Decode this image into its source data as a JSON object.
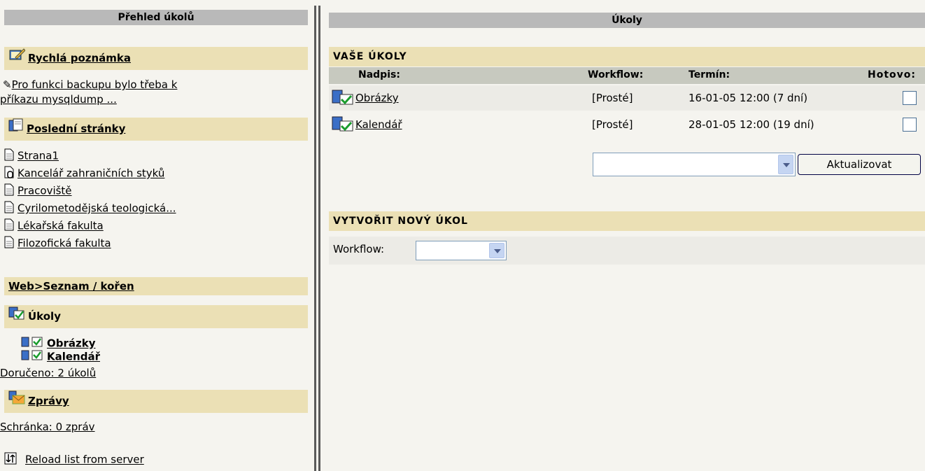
{
  "left": {
    "title": "Přehled úkolů",
    "quick_note": {
      "heading": "Rychlá poznámka",
      "line1": "Pro funkci backupu bylo třeba k",
      "line2": "příkazu mysqldump ..."
    },
    "recent_pages": {
      "heading": "Poslední stránky",
      "items": [
        "Strana1",
        "Kancelář zahraničních styků",
        "Pracoviště",
        "Cyrilometodějská teologická...",
        "Lékařská fakulta",
        "Filozofická fakulta"
      ]
    },
    "breadcrumb": "Web>Seznam / kořen",
    "tasks": {
      "heading": "Úkoly",
      "items": [
        "Obrázky",
        "Kalendář"
      ],
      "delivered": "Doručeno: 2 úkolů"
    },
    "messages": {
      "heading": "Zprávy",
      "inbox": "Schránka: 0 zpráv"
    },
    "reload": "Reload list from server"
  },
  "right": {
    "title": "Úkoly",
    "my_tasks_heading": "VAŠE ÚKOLY",
    "columns": {
      "title": "Nadpis:",
      "workflow": "Workflow:",
      "deadline": "Termín:",
      "done": "Hotovo:"
    },
    "rows": [
      {
        "title": "Obrázky",
        "workflow": "[Prosté]",
        "deadline": "16-01-05 12:00 (7 dní)"
      },
      {
        "title": "Kalendář",
        "workflow": "[Prosté]",
        "deadline": "28-01-05 12:00 (19 dní)"
      }
    ],
    "update_button": "Aktualizovat",
    "new_task_heading": "VYTVOŘIT NOVÝ ÚKOL",
    "workflow_label": "Workflow:"
  },
  "colors": {
    "section_bg": "#ebe0b5",
    "title_bar": "#b9b9b9",
    "table_header": "#c7c9bf"
  }
}
